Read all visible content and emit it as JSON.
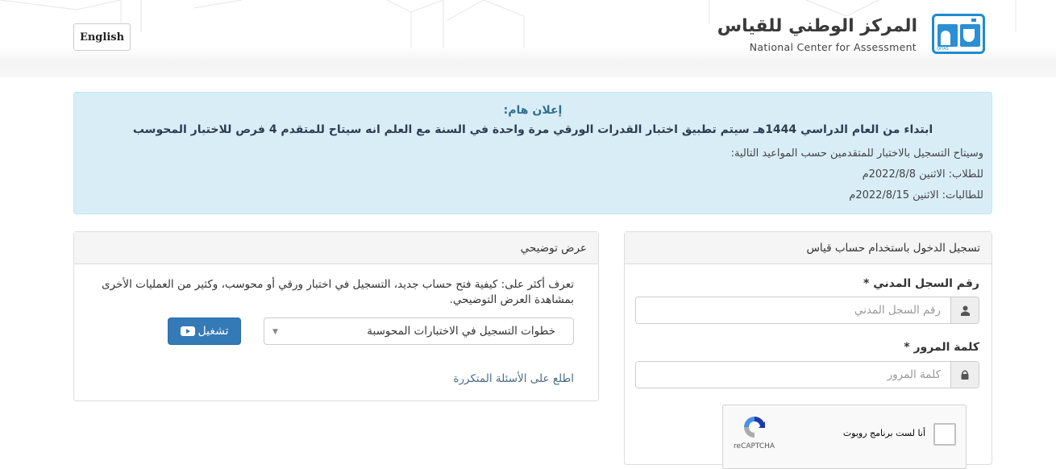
{
  "header": {
    "language_button": "English",
    "logo_arabic": "المركز الوطني للقياس",
    "logo_english": "National Center for Assessment",
    "logo_icon_caption": "QIYAS",
    "brand_color": "#1e8ccf"
  },
  "announcement": {
    "title": "إعلان هام:",
    "headline": "ابتداء من العام الدراسي 1444هـ سيتم تطبيق اختبار القدرات الورقي مرة واحدة في السنة مع العلم انه سيتاح للمتقدم 4 فرص للاختبار المحوسب",
    "lines": [
      "وسيتاح التسجيل بالاختبار للمتقدمين حسب المواعيد التالية:",
      "للطلاب: الاثنين 2022/8/8م",
      "للطالبات: الاثنين 2022/8/15م"
    ]
  },
  "demo_panel": {
    "title": "عرض توضيحي",
    "description": "تعرف أكثر على: كيفية فتح حساب جديد، التسجيل في اختبار ورقي أو محوسب، وكثير من العمليات الأخرى بمشاهدة العرض التوضيحي.",
    "select_value": "خطوات التسجيل في الاختبارات المحوسبة",
    "play_button": "تشغيل",
    "faq_link": "اطلع على الأسئلة المتكررة",
    "button_color": "#337ab7"
  },
  "login_panel": {
    "title": "تسجيل الدخول باستخدام حساب قياس",
    "national_id_label": "رقم السجل المدني *",
    "national_id_placeholder": "رقم السجل المدني",
    "national_id_value": "",
    "password_label": "كلمة المرور *",
    "password_placeholder": "كلمة المرور",
    "password_value": "",
    "captcha_text": "أنا لست برنامج روبوت",
    "captcha_brand": "reCAPTCHA"
  }
}
